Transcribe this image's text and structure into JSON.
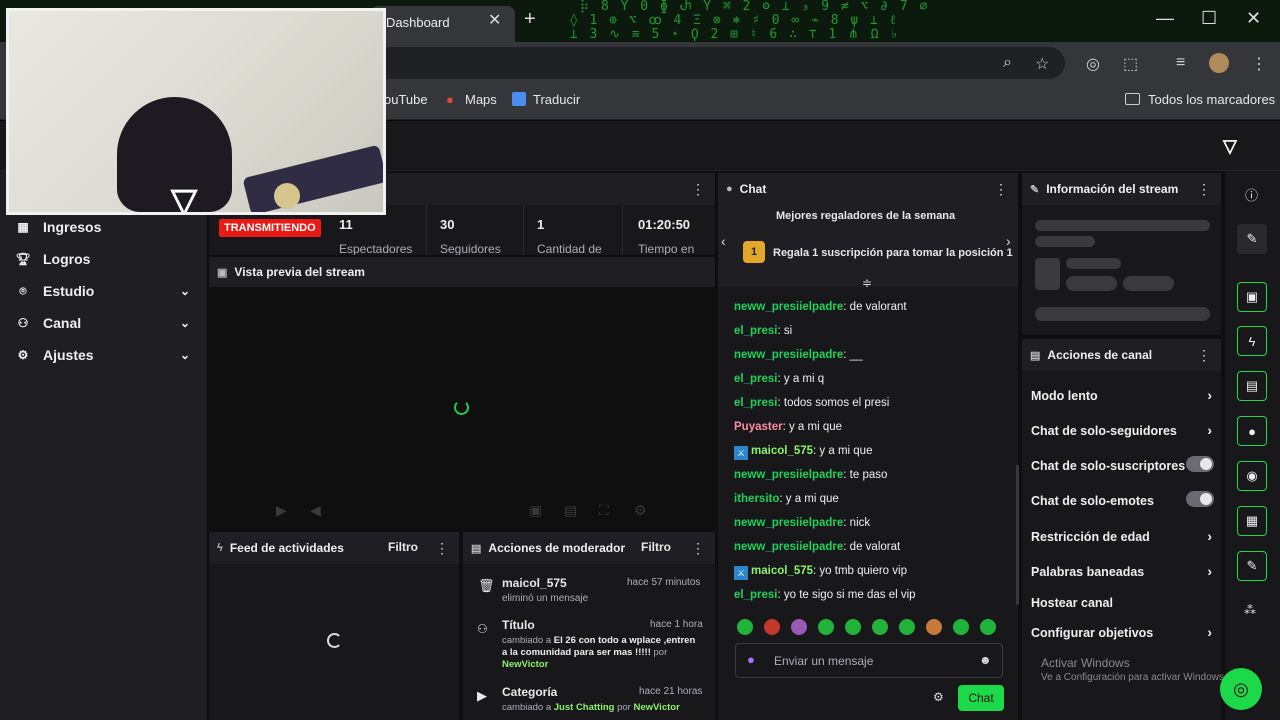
{
  "browser": {
    "tab_title": "Dashboard",
    "tab_close": "✕",
    "new_tab": "+",
    "matrix_text": "  ⡷ 8 Ÿ 0 ɸ Ⴐ Ŷ ⌘ 2 ʘ ⊥ ₃ 9 ≠ ⌥ ∂ 7 ∅\n ◊ 1 ⊕ ⌥ ꝏ 4 Ξ ⊗ ⎈ ♯ 0 ∞ ⌁ 8 ψ ⊥ ℓ\n ⊥ 3 ∿ ≡ 5 ⋆ Ϙ 2 ⊞ ♮ 6 ∴ ⊤ 1 ⋔ Ω ♭",
    "bookmarks": [
      {
        "label": "ouTube",
        "icon": "youtube-icon"
      },
      {
        "label": "Maps",
        "icon": "maps-icon"
      },
      {
        "label": "Traducir",
        "icon": "translate-icon"
      }
    ],
    "all_bookmarks": "Todos los marcadores"
  },
  "sidebar": {
    "items": [
      {
        "label": "Ingresos",
        "icon": "revenue-icon",
        "expandable": false
      },
      {
        "label": "Logros",
        "icon": "trophy-icon",
        "expandable": false
      },
      {
        "label": "Estudio",
        "icon": "studio-icon",
        "expandable": true
      },
      {
        "label": "Canal",
        "icon": "channel-icon",
        "expandable": true
      },
      {
        "label": "Ajustes",
        "icon": "settings-icon",
        "expandable": true
      }
    ]
  },
  "stats": {
    "live_badge": "TRANSMITIENDO",
    "items": [
      {
        "value": "11",
        "label": "Espectadores"
      },
      {
        "value": "30",
        "label": "Seguidores"
      },
      {
        "value": "1",
        "label": "Cantidad de"
      },
      {
        "value": "01:20:50",
        "label": "Tiempo en"
      }
    ]
  },
  "preview": {
    "title": "Vista previa del stream"
  },
  "feed": {
    "title": "Feed de actividades",
    "filter": "Filtro"
  },
  "mod_actions": {
    "title": "Acciones de moderador",
    "filter": "Filtro",
    "items": [
      {
        "title": "maicol_575",
        "time": "hace 57 minutos",
        "desc": "eliminó un mensaje"
      },
      {
        "title": "Título",
        "time": "hace 1 hora",
        "desc_pre": "cambiado a ",
        "desc_strong": "El 26 con todo a wplace ,entren a la comunidad para ser mas !!!!!",
        "desc_by": " por ",
        "desc_user": "NewVictor"
      },
      {
        "title": "Categoría",
        "time": "hace 21 horas",
        "desc_pre": "cambiado a ",
        "desc_strong": "Just Chatting",
        "desc_by": " por ",
        "desc_user": "NewVictor"
      }
    ]
  },
  "chat": {
    "title": "Chat",
    "gifters_title": "Mejores regaladores de la semana",
    "gift_rank": "1",
    "gift_text": "Regala 1 suscripción para tomar la posición 1",
    "messages": [
      {
        "user": "neww_presiielpadre",
        "text": ": de valorant",
        "color": "green",
        "mod": false
      },
      {
        "user": "el_presi",
        "text": ": si",
        "color": "green",
        "mod": false
      },
      {
        "user": "neww_presiielpadre",
        "text": ": __",
        "color": "green",
        "mod": false
      },
      {
        "user": "el_presi",
        "text": ": y a mi q",
        "color": "green",
        "mod": false
      },
      {
        "user": "el_presi",
        "text": ": todos somos el presi",
        "color": "green",
        "mod": false
      },
      {
        "user": "Puyaster",
        "text": ": y a mi que",
        "color": "pink",
        "mod": false
      },
      {
        "user": "maicol_575",
        "text": ": y a mi que",
        "color": "lime",
        "mod": true
      },
      {
        "user": "neww_presiielpadre",
        "text": ": te paso",
        "color": "green",
        "mod": false
      },
      {
        "user": "ithersito",
        "text": ": y a mi que",
        "color": "green",
        "mod": false
      },
      {
        "user": "neww_presiielpadre",
        "text": ": nick",
        "color": "green",
        "mod": false
      },
      {
        "user": "neww_presiielpadre",
        "text": ": de valorat",
        "color": "green",
        "mod": false
      },
      {
        "user": "maicol_575",
        "text": ": yo tmb quiero vip",
        "color": "lime",
        "mod": true
      },
      {
        "user": "el_presi",
        "text": ": yo te sigo si me das el vip",
        "color": "green",
        "mod": false
      }
    ],
    "input_placeholder": "Enviar un mensaje",
    "send_label": "Chat"
  },
  "stream_info": {
    "title": "Información del stream"
  },
  "channel_actions": {
    "title": "Acciones de canal",
    "items": [
      {
        "label": "Modo lento",
        "control": "chevron"
      },
      {
        "label": "Chat de solo-seguidores",
        "control": "chevron"
      },
      {
        "label": "Chat de solo-suscriptores",
        "control": "toggle",
        "on": false
      },
      {
        "label": "Chat de solo-emotes",
        "control": "toggle",
        "on": false
      },
      {
        "label": "Restricción de edad",
        "control": "chevron"
      },
      {
        "label": "Palabras baneadas",
        "control": "chevron"
      },
      {
        "label": "Hostear canal",
        "control": "none"
      },
      {
        "label": "Configurar objetivos",
        "control": "chevron"
      }
    ]
  },
  "windows_watermark": {
    "line1": "Activar Windows",
    "line2": "Ve a Configuración para activar Windows."
  },
  "colors": {
    "accent": "#1bd948",
    "live": "#e91916",
    "bg": "#0e0e10",
    "panel": "#18181b"
  }
}
